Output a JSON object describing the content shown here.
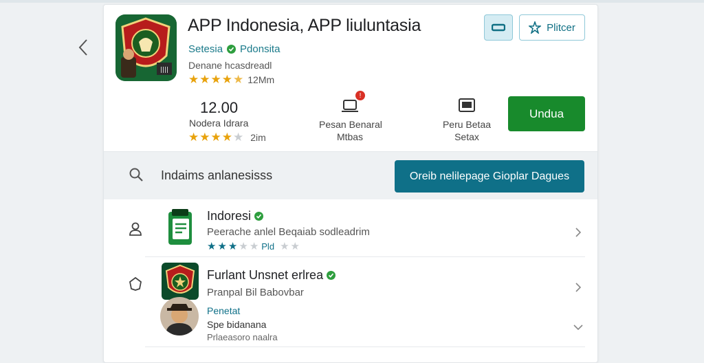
{
  "app": {
    "title": "APP Indonesia, APP liuluntasia",
    "developer": "Setesia",
    "developer_tag": "Pdonsita",
    "subtitle": "Denane hcasdreadl",
    "rating_stars": 4.5,
    "rating_count": "12Mm"
  },
  "header_buttons": {
    "filter_label": "Plitcer"
  },
  "stats": {
    "big_value": "12.00",
    "stat1_label": "Nodera Idrara",
    "stat1_stars": 4,
    "stat1_count": "2im",
    "stat2_label_line1": "Pesan Benaral",
    "stat2_label_line2": "Mtbas",
    "stat2_badge": "!",
    "stat3_label_line1": "Peru Betaa",
    "stat3_label_line2": "Setax"
  },
  "install": {
    "label": "Undua"
  },
  "search": {
    "query": "Indaims anlanesisss",
    "promo_label": "Oreib nelilepage Gioplar Dagues"
  },
  "list": {
    "item1": {
      "title": "Indoresi",
      "subtitle": "Peerache anlel Beqaiab sodleadrim",
      "stars": 2.5,
      "tag": "Pld"
    },
    "item2": {
      "title": "Furlant Unsnet erlrea",
      "subtitle": "Pranpal Bil Babovbar",
      "teal_text": "Penetat",
      "person_text": "Spe bidanana",
      "small_text": "Prlaeasoro naalra"
    }
  },
  "colors": {
    "accent": "#0f7088",
    "install_green": "#188a2c",
    "star": "#e8a20c",
    "verified": "#2e9e3e",
    "badge_red": "#d93025"
  }
}
